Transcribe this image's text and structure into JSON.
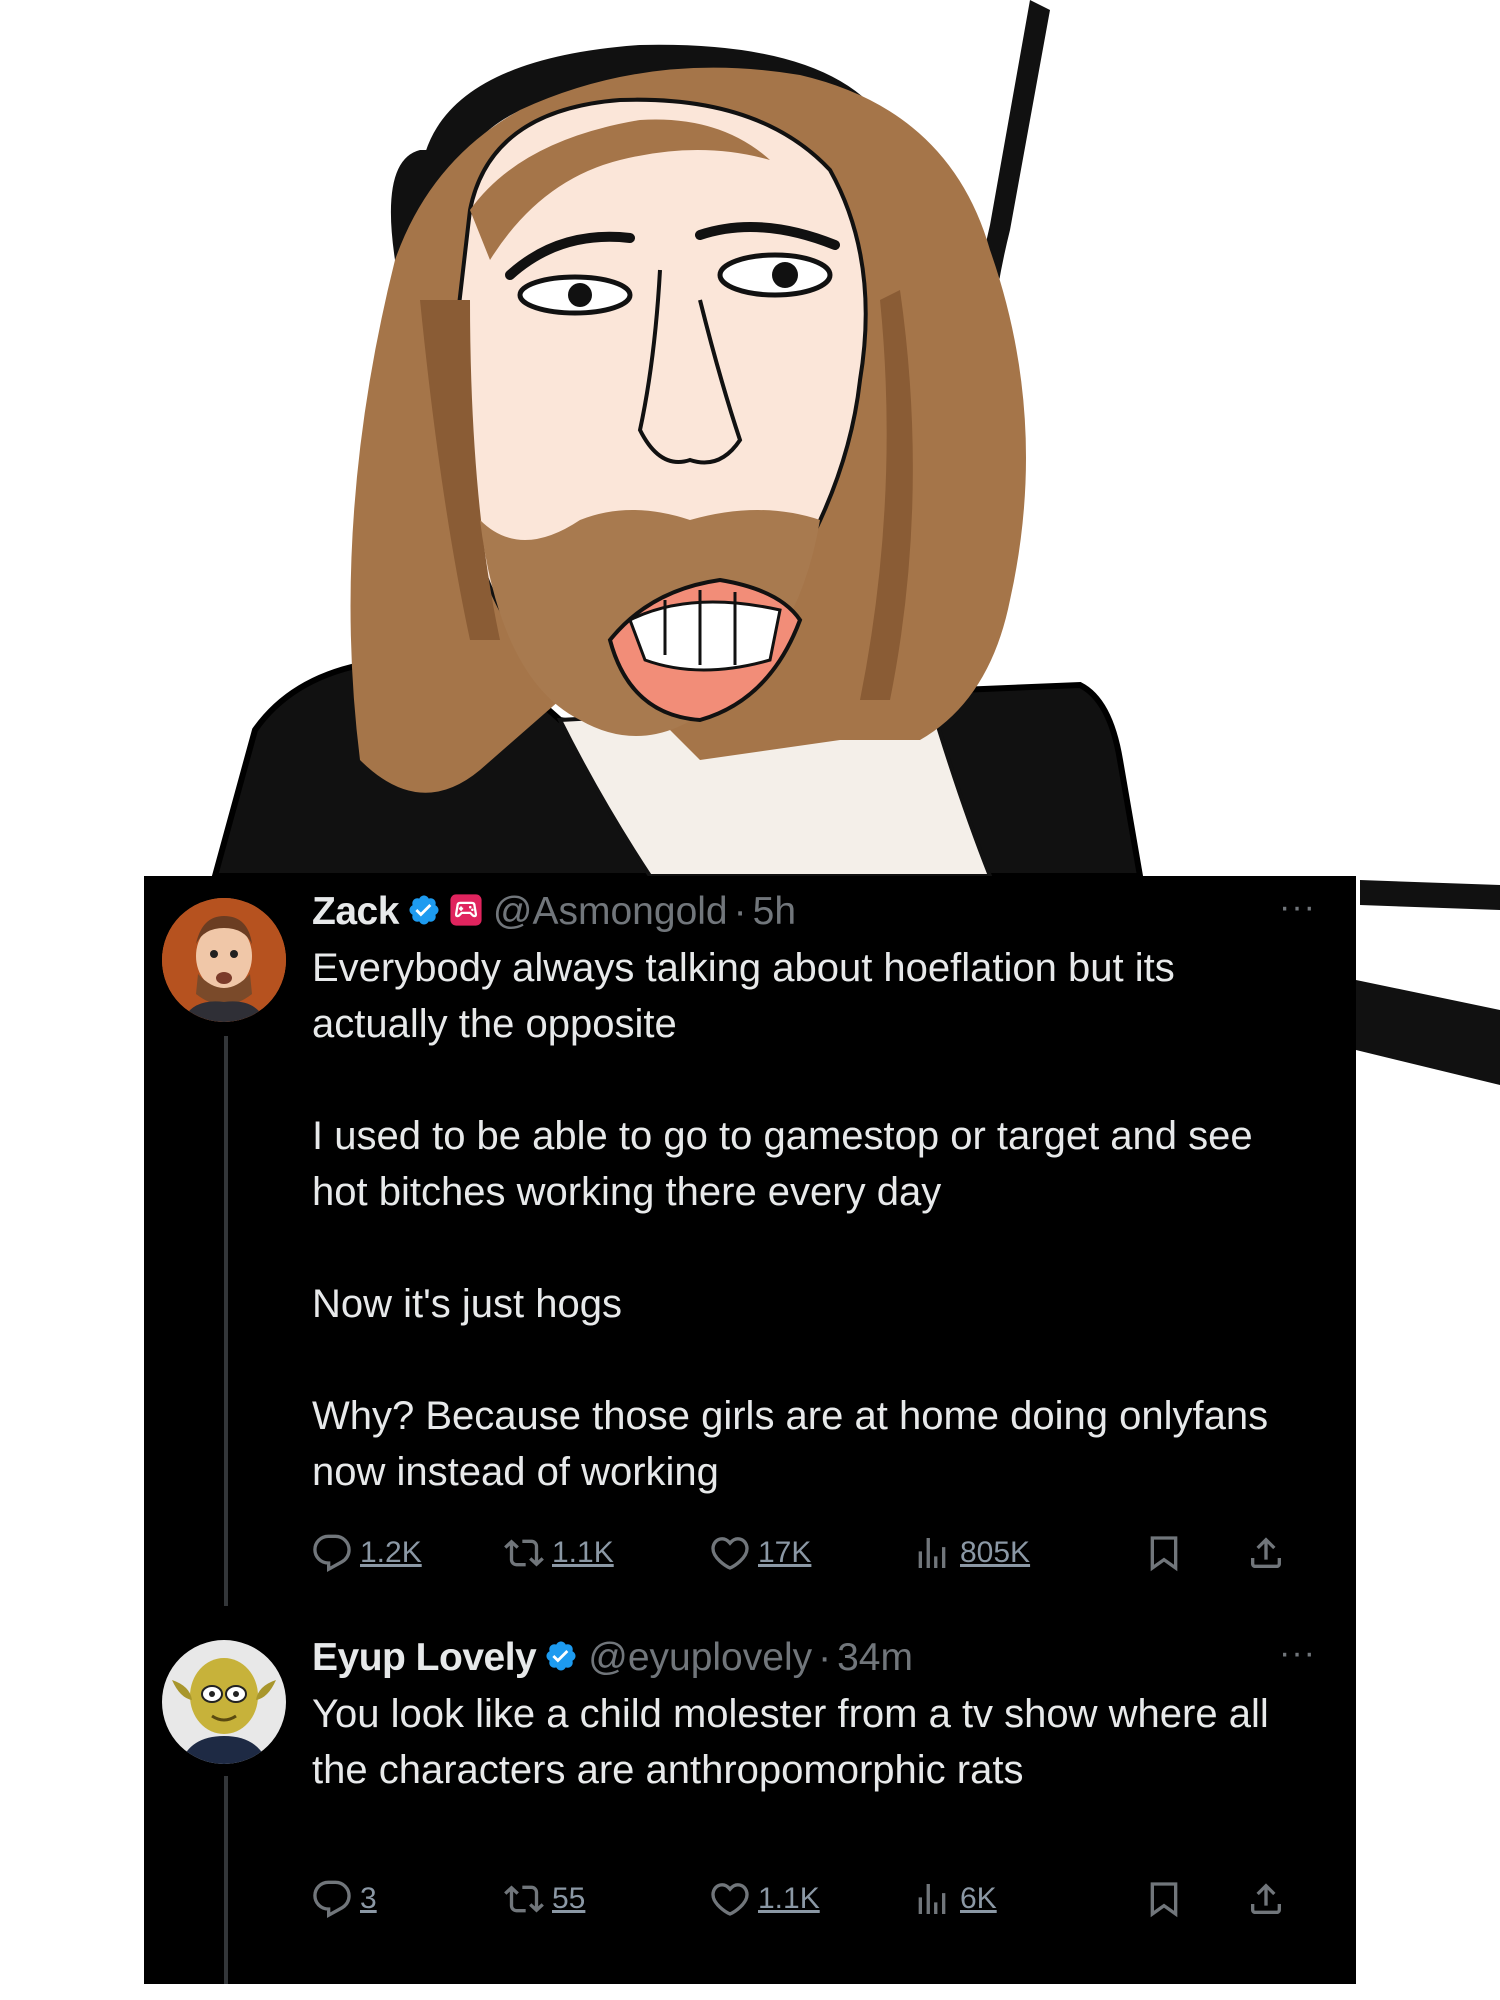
{
  "colors": {
    "background": "#000000",
    "text": "#e7e9ea",
    "muted": "#71767b",
    "verified": "#1d9bf0",
    "affiliate": "#f91880"
  },
  "meme": {
    "description_icon": "cartoon-man-with-headset-icon"
  },
  "tweets": [
    {
      "name": "Zack",
      "handle": "@Asmongold",
      "sep": "·",
      "time": "5h",
      "verified": true,
      "affiliate_icon": "gamepad-badge-icon",
      "more": "···",
      "paragraphs": [
        "Everybody always talking about hoeflation but its actually the opposite",
        "I used to be able to go to gamestop or target and see hot bitches working there every day",
        "Now it's just hogs",
        "Why? Because those girls are at home doing onlyfans now instead of working"
      ],
      "stats": {
        "replies": "1.2K",
        "reposts": "1.1K",
        "likes": "17K",
        "views": "805K"
      }
    },
    {
      "name": "Eyup Lovely",
      "handle": "@eyuplovely",
      "sep": "·",
      "time": "34m",
      "verified": true,
      "more": "···",
      "paragraphs": [
        "You look like a child molester from a tv show where all the characters are anthropomorphic rats"
      ],
      "stats": {
        "replies": "3",
        "reposts": "55",
        "likes": "1.1K",
        "views": "6K"
      }
    }
  ]
}
